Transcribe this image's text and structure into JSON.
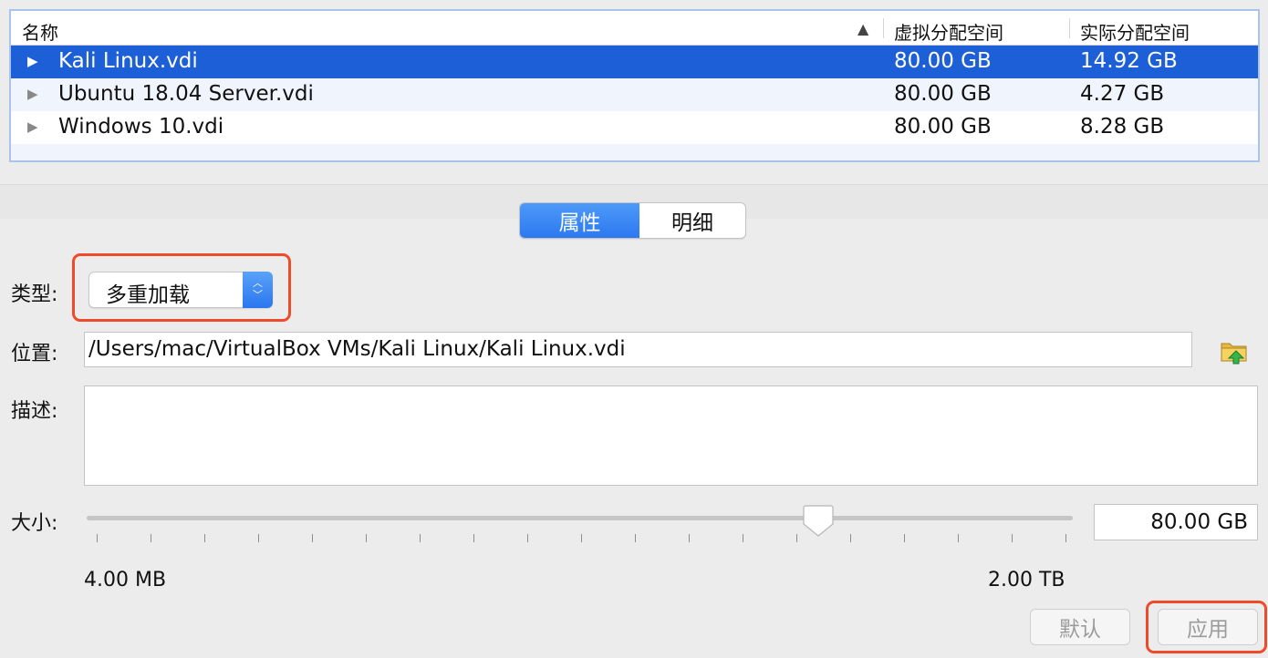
{
  "table": {
    "columns": {
      "name": "名称",
      "sort_indicator": "▲",
      "virtual_size": "虚拟分配空间",
      "actual_size": "实际分配空间"
    },
    "rows": [
      {
        "name": "Kali Linux.vdi",
        "virtual_size": "80.00 GB",
        "actual_size": "14.92 GB",
        "selected": true
      },
      {
        "name": "Ubuntu 18.04 Server.vdi",
        "virtual_size": "80.00 GB",
        "actual_size": "4.27 GB",
        "selected": false
      },
      {
        "name": "Windows 10.vdi",
        "virtual_size": "80.00 GB",
        "actual_size": "8.28 GB",
        "selected": false
      }
    ]
  },
  "tabs": {
    "properties": "属性",
    "details": "明细",
    "active": "properties"
  },
  "form": {
    "type_label": "类型:",
    "type_value": "多重加载",
    "location_label": "位置:",
    "location_value": "/Users/mac/VirtualBox VMs/Kali Linux/Kali Linux.vdi",
    "description_label": "描述:",
    "description_value": "",
    "size_label": "大小:",
    "size_value": "80.00 GB",
    "size_min": "4.00 MB",
    "size_max": "2.00 TB",
    "slider_fraction": 0.75
  },
  "buttons": {
    "default": "默认",
    "apply": "应用"
  },
  "colors": {
    "selection": "#1d5fd6",
    "accent": "#2c78f0",
    "highlight": "#ef4a2a"
  },
  "icons": {
    "row_expand": "disclosure-triangle",
    "location_browse": "folder-up-icon"
  }
}
